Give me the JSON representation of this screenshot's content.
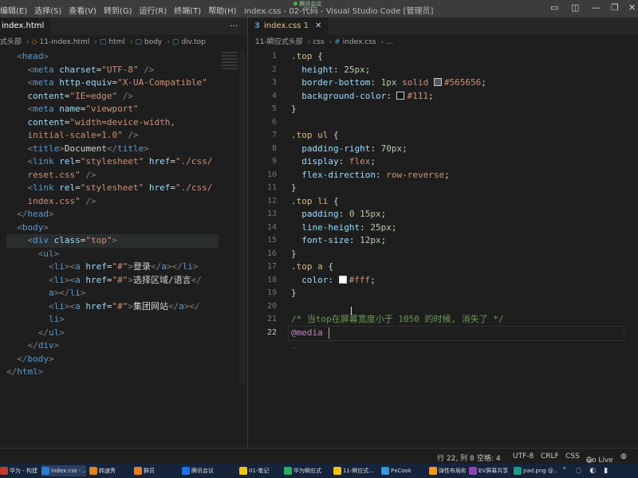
{
  "menu": [
    "编辑(E)",
    "选择(S)",
    "查看(V)",
    "转到(G)",
    "运行(R)",
    "终端(T)",
    "帮助(H)"
  ],
  "window_title": "index.css - 02-代码 - Visual Studio Code [管理员]",
  "meeting_label": "腾讯会议",
  "left_tab": {
    "label": "index.html"
  },
  "left_crumbs": [
    "式头部",
    "11-index.html",
    "html",
    "body",
    "div.top"
  ],
  "right_tab": {
    "label": "index.css 1"
  },
  "right_crumbs": [
    "11-瞬应式头部",
    "css",
    "index.css",
    "..."
  ],
  "html_lines": [
    [
      [
        "ang",
        "  <"
      ],
      [
        "tag",
        "head"
      ],
      [
        "ang",
        ">"
      ]
    ],
    [
      [
        "ang",
        "    <"
      ],
      [
        "tag",
        "meta"
      ],
      [
        "attr",
        " charset"
      ],
      [
        "txt",
        "="
      ],
      [
        "str",
        "\"UTF-8\""
      ],
      [
        "ang",
        " />"
      ]
    ],
    [
      [
        "ang",
        "    <"
      ],
      [
        "tag",
        "meta"
      ],
      [
        "attr",
        " http-equiv"
      ],
      [
        "txt",
        "="
      ],
      [
        "str",
        "\"X-UA-Compatible\""
      ]
    ],
    [
      [
        "attr",
        "    content"
      ],
      [
        "txt",
        "="
      ],
      [
        "str",
        "\"IE=edge\""
      ],
      [
        "ang",
        " />"
      ]
    ],
    [
      [
        "ang",
        "    <"
      ],
      [
        "tag",
        "meta"
      ],
      [
        "attr",
        " name"
      ],
      [
        "txt",
        "="
      ],
      [
        "str",
        "\"viewport\""
      ]
    ],
    [
      [
        "attr",
        "    content"
      ],
      [
        "txt",
        "="
      ],
      [
        "str",
        "\"width=device-width,"
      ]
    ],
    [
      [
        "str",
        "    initial-scale=1.0\""
      ],
      [
        "ang",
        " />"
      ]
    ],
    [
      [
        "ang",
        "    <"
      ],
      [
        "tag",
        "title"
      ],
      [
        "ang",
        ">"
      ],
      [
        "txt",
        "Document"
      ],
      [
        "ang",
        "</"
      ],
      [
        "tag",
        "title"
      ],
      [
        "ang",
        ">"
      ]
    ],
    [
      [
        "ang",
        "    <"
      ],
      [
        "tag",
        "link"
      ],
      [
        "attr",
        " rel"
      ],
      [
        "txt",
        "="
      ],
      [
        "str",
        "\"stylesheet\""
      ],
      [
        "attr",
        " href"
      ],
      [
        "txt",
        "="
      ],
      [
        "str",
        "\"./css/"
      ]
    ],
    [
      [
        "str",
        "    reset.css\""
      ],
      [
        "ang",
        " />"
      ]
    ],
    [
      [
        "ang",
        "    <"
      ],
      [
        "tag",
        "link"
      ],
      [
        "attr",
        " rel"
      ],
      [
        "txt",
        "="
      ],
      [
        "str",
        "\"stylesheet\""
      ],
      [
        "attr",
        " href"
      ],
      [
        "txt",
        "="
      ],
      [
        "str",
        "\"./css/"
      ]
    ],
    [
      [
        "str",
        "    index.css\""
      ],
      [
        "ang",
        " />"
      ]
    ],
    [
      [
        "ang",
        "  </"
      ],
      [
        "tag",
        "head"
      ],
      [
        "ang",
        ">"
      ]
    ],
    [
      [
        "ang",
        "  <"
      ],
      [
        "tag",
        "body"
      ],
      [
        "ang",
        ">"
      ]
    ],
    [
      [
        "ang",
        "    <"
      ],
      [
        "tag",
        "div"
      ],
      [
        "attr",
        " class"
      ],
      [
        "txt",
        "="
      ],
      [
        "str",
        "\"top\""
      ],
      [
        "ang",
        ">"
      ]
    ],
    [
      [
        "ang",
        "      <"
      ],
      [
        "tag",
        "ul"
      ],
      [
        "ang",
        ">"
      ]
    ],
    [
      [
        "ang",
        "        <"
      ],
      [
        "tag",
        "li"
      ],
      [
        "ang",
        "><"
      ],
      [
        "tag",
        "a"
      ],
      [
        "attr",
        " href"
      ],
      [
        "txt",
        "="
      ],
      [
        "str",
        "\"#\""
      ],
      [
        "ang",
        ">"
      ],
      [
        "txt",
        "登录"
      ],
      [
        "ang",
        "</"
      ],
      [
        "tag",
        "a"
      ],
      [
        "ang",
        "></"
      ],
      [
        "tag",
        "li"
      ],
      [
        "ang",
        ">"
      ]
    ],
    [
      [
        "ang",
        "        <"
      ],
      [
        "tag",
        "li"
      ],
      [
        "ang",
        "><"
      ],
      [
        "tag",
        "a"
      ],
      [
        "attr",
        " href"
      ],
      [
        "txt",
        "="
      ],
      [
        "str",
        "\"#\""
      ],
      [
        "ang",
        ">"
      ],
      [
        "txt",
        "选择区域/语言"
      ],
      [
        "ang",
        "</"
      ]
    ],
    [
      [
        "tag",
        "        a"
      ],
      [
        "ang",
        "></"
      ],
      [
        "tag",
        "li"
      ],
      [
        "ang",
        ">"
      ]
    ],
    [
      [
        "ang",
        "        <"
      ],
      [
        "tag",
        "li"
      ],
      [
        "ang",
        "><"
      ],
      [
        "tag",
        "a"
      ],
      [
        "attr",
        " href"
      ],
      [
        "txt",
        "="
      ],
      [
        "str",
        "\"#\""
      ],
      [
        "ang",
        ">"
      ],
      [
        "txt",
        "集团网站"
      ],
      [
        "ang",
        "</"
      ],
      [
        "tag",
        "a"
      ],
      [
        "ang",
        "></"
      ]
    ],
    [
      [
        "tag",
        "        li"
      ],
      [
        "ang",
        ">"
      ]
    ],
    [
      [
        "ang",
        "      </"
      ],
      [
        "tag",
        "ul"
      ],
      [
        "ang",
        ">"
      ]
    ],
    [
      [
        "ang",
        "    </"
      ],
      [
        "tag",
        "div"
      ],
      [
        "ang",
        ">"
      ]
    ],
    [
      [
        "ang",
        "  </"
      ],
      [
        "tag",
        "body"
      ],
      [
        "ang",
        ">"
      ]
    ],
    [
      [
        "ang",
        "</"
      ],
      [
        "tag",
        "html"
      ],
      [
        "ang",
        ">"
      ]
    ]
  ],
  "css_lines": [
    [
      [
        "sel",
        ".top"
      ],
      [
        "txt",
        " {"
      ]
    ],
    [
      [
        "prop",
        "  height"
      ],
      [
        "txt",
        ": "
      ],
      [
        "num",
        "25px"
      ],
      [
        "txt",
        ";"
      ]
    ],
    [
      [
        "prop",
        "  border-bottom"
      ],
      [
        "txt",
        ": "
      ],
      [
        "num",
        "1px"
      ],
      [
        "val",
        " solid "
      ],
      [
        "swatch",
        "#565656"
      ],
      [
        "val",
        "#565656"
      ],
      [
        "txt",
        ";"
      ]
    ],
    [
      [
        "prop",
        "  background-color"
      ],
      [
        "txt",
        ": "
      ],
      [
        "swatch",
        "#111111"
      ],
      [
        "val",
        "#111"
      ],
      [
        "txt",
        ";"
      ]
    ],
    [
      [
        "txt",
        "}"
      ]
    ],
    [
      [
        "txt",
        ""
      ]
    ],
    [
      [
        "sel",
        ".top ul"
      ],
      [
        "txt",
        " {"
      ]
    ],
    [
      [
        "prop",
        "  padding-right"
      ],
      [
        "txt",
        ": "
      ],
      [
        "num",
        "70px"
      ],
      [
        "txt",
        ";"
      ]
    ],
    [
      [
        "prop",
        "  display"
      ],
      [
        "txt",
        ": "
      ],
      [
        "val",
        "flex"
      ],
      [
        "txt",
        ";"
      ]
    ],
    [
      [
        "prop",
        "  flex-direction"
      ],
      [
        "txt",
        ": "
      ],
      [
        "val",
        "row-reverse"
      ],
      [
        "txt",
        ";"
      ]
    ],
    [
      [
        "txt",
        "}"
      ]
    ],
    [
      [
        "sel",
        ".top li"
      ],
      [
        "txt",
        " {"
      ]
    ],
    [
      [
        "prop",
        "  padding"
      ],
      [
        "txt",
        ": "
      ],
      [
        "num",
        "0 15px"
      ],
      [
        "txt",
        ";"
      ]
    ],
    [
      [
        "prop",
        "  line-height"
      ],
      [
        "txt",
        ": "
      ],
      [
        "num",
        "25px"
      ],
      [
        "txt",
        ";"
      ]
    ],
    [
      [
        "prop",
        "  font-size"
      ],
      [
        "txt",
        ": "
      ],
      [
        "num",
        "12px"
      ],
      [
        "txt",
        ";"
      ]
    ],
    [
      [
        "txt",
        "}"
      ]
    ],
    [
      [
        "sel",
        ".top a"
      ],
      [
        "txt",
        " {"
      ]
    ],
    [
      [
        "prop",
        "  color"
      ],
      [
        "txt",
        ": "
      ],
      [
        "swatch",
        "#ffffff"
      ],
      [
        "val",
        "#fff"
      ],
      [
        "txt",
        ";"
      ]
    ],
    [
      [
        "txt",
        "}"
      ]
    ],
    [
      [
        "txt",
        ""
      ]
    ],
    [
      [
        "com",
        "/* 当top在屏幕宽度小于 1050 的时候, 消失了 */"
      ]
    ],
    [
      [
        "kw",
        "@media"
      ]
    ]
  ],
  "css_line_numbers": [
    "1",
    "2",
    "3",
    "4",
    "5",
    "6",
    "7",
    "8",
    "9",
    "10",
    "11",
    "12",
    "13",
    "14",
    "15",
    "16",
    "17",
    "18",
    "19",
    "20",
    "21",
    "22"
  ],
  "css_current_line": "22",
  "status": {
    "position": "行 22, 列 8",
    "spaces": "空格: 4",
    "encoding": "UTF-8",
    "eol": "CRLF",
    "language": "CSS",
    "golive": "Go Live"
  },
  "taskbar": [
    {
      "label": "华为 - 构建..."
    },
    {
      "label": "index.css - ..."
    },
    {
      "label": "韩速秀"
    },
    {
      "label": "群员"
    },
    {
      "label": "腾讯会议"
    },
    {
      "label": "01-笔记"
    },
    {
      "label": "华为瞬应式"
    },
    {
      "label": "11-瞬应式..."
    },
    {
      "label": "PxCook"
    },
    {
      "label": "弹性布局和..."
    },
    {
      "label": "EV屏幕共享"
    },
    {
      "label": "pad.png @..."
    }
  ],
  "colors": {
    "accent": "#007acc",
    "taskbar": "#15233b"
  }
}
